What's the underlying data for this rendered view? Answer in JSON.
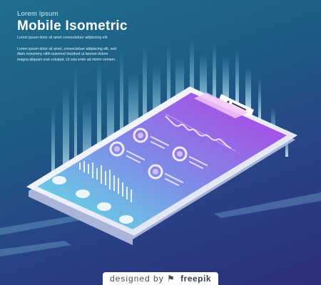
{
  "header": {
    "eyebrow": "Lorem Ipsum",
    "title": "Mobile Isometric",
    "tagline": "Lorem ipsum dolor sit amet consectetuer adipiscing elit"
  },
  "body_text": "Lorem ipsum dolor sit amet, consectetuer adipiscing elit, sed diam nonummy nibh euismod tincidunt ut laoreet dolore magna aliquam erat volutpat. Ut wisi enim ad minim veniam.",
  "credit": {
    "prefix": "designed by",
    "brand": "freepik"
  },
  "colors": {
    "bg_top": "#1f6f8f",
    "bg_bottom": "#2b2f78",
    "screen_start": "#5ee0e0",
    "screen_end": "#a83ee2",
    "glow": "#bdf6ff"
  }
}
